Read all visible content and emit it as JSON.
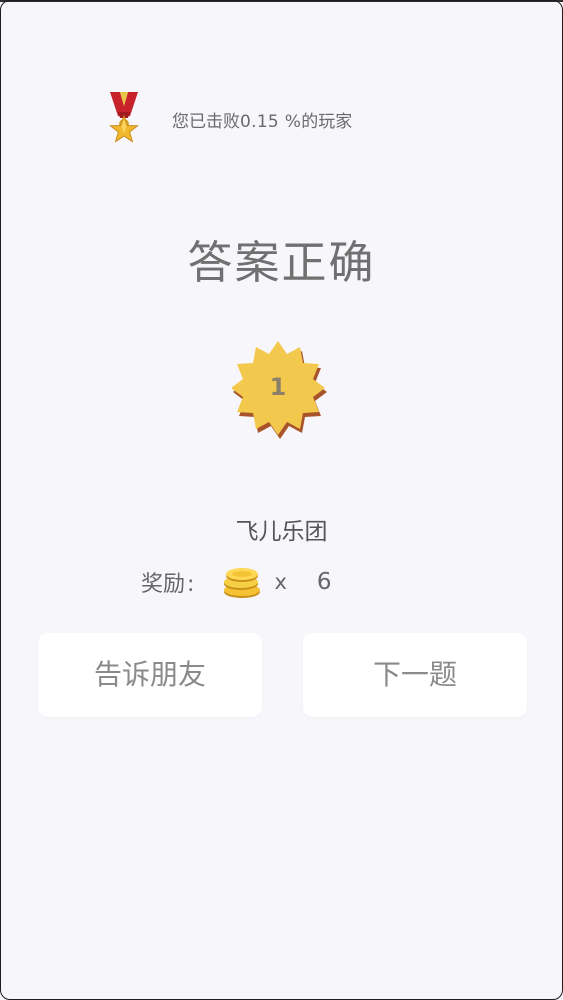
{
  "rank": {
    "prefix": "您已击败",
    "percent": "0.15 %",
    "suffix": "的玩家"
  },
  "title": "答案正确",
  "level": {
    "number": "1"
  },
  "answer": "飞儿乐团",
  "reward": {
    "label": "奖励",
    "colon": ":",
    "icon": "gold-coins-icon",
    "times": "x",
    "count": "6"
  },
  "buttons": {
    "share": "告诉朋友",
    "next": "下一题"
  },
  "colors": {
    "background": "#f7f6fb",
    "badge": "#f2c94c",
    "badge_shadow": "#a8532a",
    "button": "#ffffff",
    "text": "#707070"
  }
}
